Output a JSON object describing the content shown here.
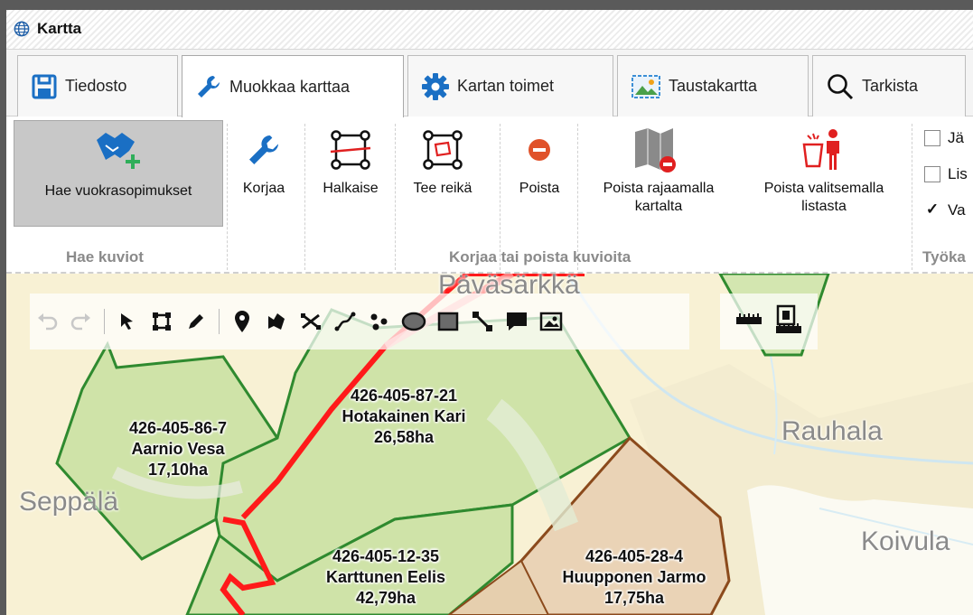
{
  "window": {
    "title": "Kartta"
  },
  "tabs": [
    {
      "label": "Tiedosto",
      "icon": "save-icon"
    },
    {
      "label": "Muokkaa karttaa",
      "icon": "wrench-icon",
      "active": true
    },
    {
      "label": "Kartan toimet",
      "icon": "gear-icon"
    },
    {
      "label": "Taustakartta",
      "icon": "image-icon"
    },
    {
      "label": "Tarkista",
      "icon": "magnifier-icon"
    }
  ],
  "ribbon": {
    "fetch_button": "Hae vuokrasopimukset",
    "fix_button": "Korjaa",
    "split_button": "Halkaise",
    "hole_button": "Tee reikä",
    "delete_button": "Poista",
    "delete_by_area_line1": "Poista rajaamalla",
    "delete_by_area_line2": "kartalta",
    "delete_from_list_line1": "Poista valitsemalla",
    "delete_from_list_line2": "listasta",
    "group_fetch": "Hae kuviot",
    "group_fix": "Korjaa tai poista kuvioita",
    "group_tools": "Työka",
    "checkboxes": [
      {
        "label": "Jä",
        "checked": false
      },
      {
        "label": "Lis",
        "checked": false
      },
      {
        "label": "Va",
        "checked": true
      }
    ]
  },
  "map": {
    "places": {
      "top": "Päväsärkkä",
      "east": "Rauhala",
      "west": "Seppälä",
      "southeast": "Koivula"
    },
    "parcels": [
      {
        "id": "426-405-86-7",
        "owner": "Aarnio Vesa",
        "area": "17,10ha"
      },
      {
        "id": "426-405-87-21",
        "owner": "Hotakainen Kari",
        "area": "26,58ha"
      },
      {
        "id": "426-405-12-35",
        "owner": "Karttunen Eelis",
        "area": "42,79ha"
      },
      {
        "id": "426-405-28-4",
        "owner": "Huupponen Jarmo",
        "area": "17,75ha"
      }
    ],
    "colors": {
      "parcel_green_border": "#2f8a2f",
      "parcel_green_fill": "#cfe3a8",
      "parcel_brown_border": "#8b4a1c",
      "parcel_brown_fill": "#ead3b6",
      "road_red": "#ff1a1a"
    }
  },
  "draw_toolbar": [
    "undo-icon",
    "redo-icon",
    "select-arrow-icon",
    "box-select-icon",
    "pencil-icon",
    "map-pin-icon",
    "polygon-icon",
    "split-icon",
    "line-icon",
    "multipoint-icon",
    "ellipse-icon",
    "rectangle-icon",
    "connector-icon",
    "comment-icon",
    "picture-icon"
  ],
  "measure_toolbar": [
    "ruler-icon",
    "area-measure-icon"
  ]
}
